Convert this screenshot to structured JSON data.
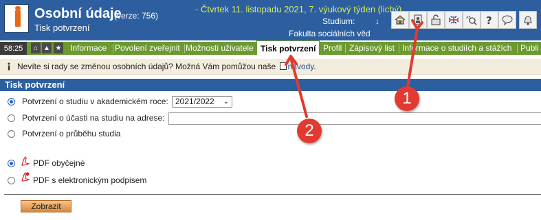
{
  "header": {
    "title": "Osobní údaje",
    "version": "(verze: 756)",
    "subtitle": "Tisk potvrzení",
    "date_line": "- Čtvrtek 11. listopadu 2021, 7. výukový týden (lichý)",
    "study_label": "Studium:",
    "study_arrow": "↓",
    "faculty": "Fakulta sociálních věd",
    "icons": [
      "home-icon",
      "user-card-icon",
      "lock-icon",
      "language-flag-icon",
      "dictionary-search-icon",
      "help-icon",
      "chat-icon",
      "bell-icon"
    ]
  },
  "nav": {
    "clock": "58:25",
    "icons": [
      "home-icon",
      "chevron-up-icon",
      "star-icon"
    ],
    "tabs": [
      {
        "label": "Informace"
      },
      {
        "label": "Povolení zveřejnit"
      },
      {
        "label": "Možnosti uživatele"
      },
      {
        "label": "Tisk potvrzení",
        "active": true
      },
      {
        "label": "Profil"
      },
      {
        "label": "Zápisový list"
      },
      {
        "label": "Informace o studiích a stážích"
      },
      {
        "label": "Publi"
      }
    ]
  },
  "info": {
    "text": "Nevíte si rady se změnou osobních údajů? Možná Vám pomůžou naše",
    "link": "návody",
    "end": "."
  },
  "section": {
    "title": "Tisk potvrzení",
    "options": [
      {
        "label": "Potvrzení o studiu v akademickém roce:",
        "selected": true
      },
      {
        "label": "Potvrzení o účasti na studiu na adrese:",
        "selected": false
      },
      {
        "label": "Potvrzení o průběhu studia",
        "selected": false
      }
    ],
    "year_select": "2021/2022",
    "address_value": "",
    "pdf_options": [
      {
        "label": "PDF obyčejné",
        "selected": true
      },
      {
        "label": "PDF s elektronickým podpisem",
        "selected": false
      }
    ],
    "submit_label": "Zobrazit"
  },
  "annotations": {
    "callout1": "1",
    "callout2": "2",
    "color": "#e23a30"
  },
  "colors": {
    "header": "#2d5fa0",
    "nav": "#6d9a30",
    "date": "#d8ef55"
  }
}
